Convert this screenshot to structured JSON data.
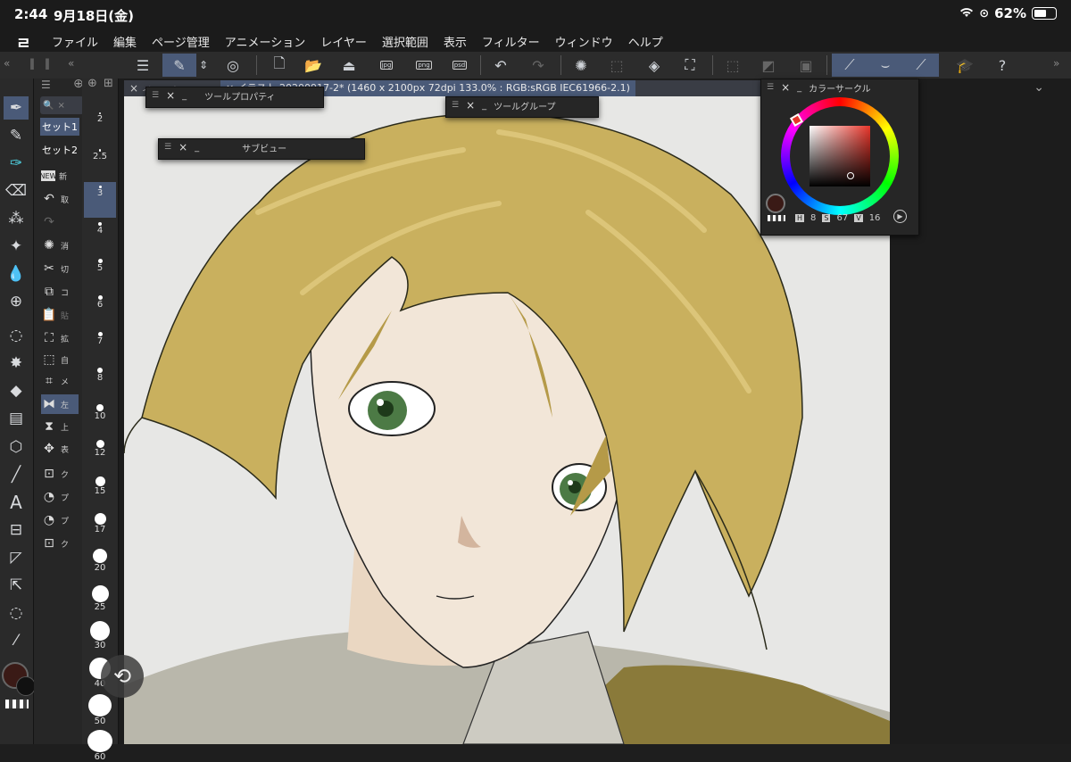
{
  "status": {
    "time": "2:44",
    "date": "9月18日(金)",
    "battery": "62%"
  },
  "menu": {
    "logo": "ㄹ",
    "items": [
      "ファイル",
      "編集",
      "ページ管理",
      "アニメーション",
      "レイヤー",
      "選択範囲",
      "表示",
      "フィルター",
      "ウィンドウ",
      "ヘルプ"
    ]
  },
  "doc_tab": {
    "title_short": "イラスト 2020",
    "title": "イラスト 20200917-2* (1460 x 2100px 72dpi 133.0% : RGB:sRGB IEC61966-2.1)"
  },
  "subtool": {
    "set1": "セット1",
    "set2": "セット2",
    "items": [
      "新",
      "取",
      "",
      "消",
      "切",
      "コ",
      "貼",
      "拡",
      "自",
      "メ",
      "左",
      "上",
      "表",
      "ク",
      "プ",
      "プ",
      "ク"
    ]
  },
  "brush_sizes": [
    "2",
    "2.5",
    "3",
    "4",
    "5",
    "6",
    "7",
    "8",
    "10",
    "12",
    "15",
    "17",
    "20",
    "25",
    "30",
    "40",
    "50",
    "60"
  ],
  "selected_brush_size": "3",
  "palettes": {
    "tool_property": "ツールプロパティ",
    "tool_group": "ツールグループ",
    "sub_view": "サブビュー",
    "color_circle": "カラーサークル"
  },
  "color": {
    "h_label": "H",
    "h": "8",
    "s_label": "S",
    "s": "67",
    "v_label": "V",
    "v": "16",
    "main": "#3a1a16"
  },
  "colors": {
    "accent": "#4a5a78",
    "hair": "#c9b05e",
    "skin": "#f1e4d6",
    "eye": "#4c7a45"
  }
}
